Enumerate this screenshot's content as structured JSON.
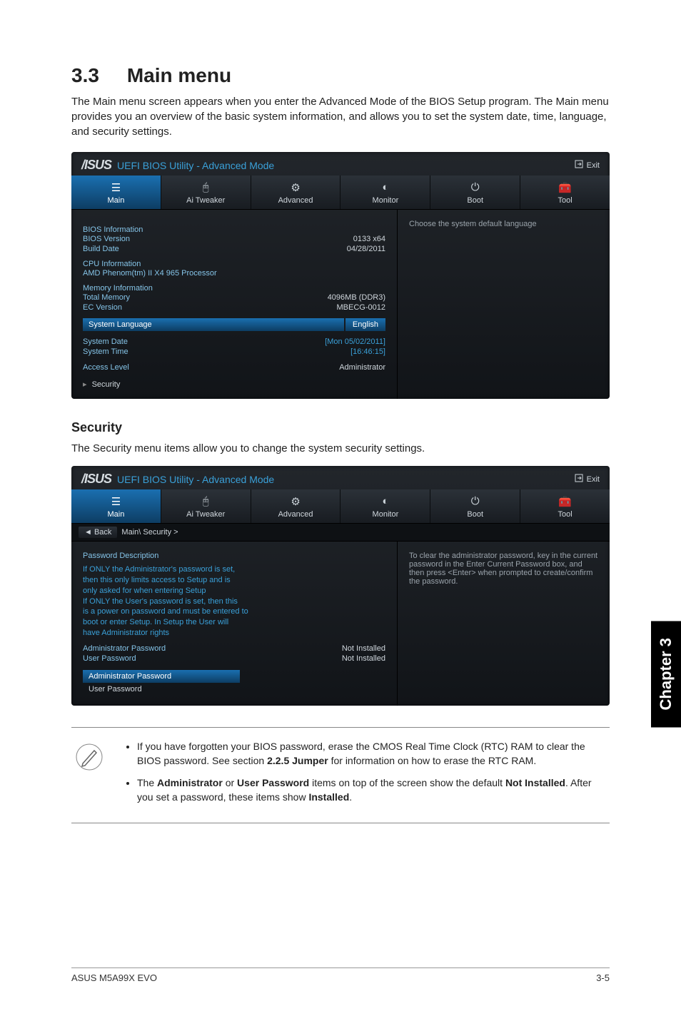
{
  "section": {
    "number": "3.3",
    "title": "Main menu"
  },
  "intro": "The Main menu screen appears when you enter the Advanced Mode of the BIOS Setup program. The Main menu provides you an overview of the basic system information, and allows you to set the system date, time, language, and security settings.",
  "bios_common": {
    "logo": "/ISUS",
    "subtitle": "UEFI BIOS Utility - Advanced Mode",
    "exit_label": "Exit",
    "tabs": [
      {
        "label": "Main",
        "icon": "list-icon"
      },
      {
        "label": "Ai  Tweaker",
        "icon": "slider-icon"
      },
      {
        "label": "Advanced",
        "icon": "chip-icon"
      },
      {
        "label": "Monitor",
        "icon": "gauge-icon"
      },
      {
        "label": "Boot",
        "icon": "power-icon"
      },
      {
        "label": "Tool",
        "icon": "toolbox-icon"
      }
    ]
  },
  "bios1": {
    "right_help": "Choose the system default language",
    "bios_info_title": "BIOS Information",
    "bios_version_label": "BIOS Version",
    "bios_version_value": "0133 x64",
    "build_date_label": "Build Date",
    "build_date_value": "04/28/2011",
    "cpu_info_title": "CPU Information",
    "cpu_name": "AMD Phenom(tm) II X4 965 Processor",
    "mem_info_title": "Memory Information",
    "total_memory_label": "Total Memory",
    "total_memory_value": "4096MB (DDR3)",
    "ec_version_label": "EC Version",
    "ec_version_value": "MBECG-0012",
    "system_language_label": "System Language",
    "system_language_value": "English",
    "system_date_label": "System Date",
    "system_date_value": "[Mon 05/02/2011]",
    "system_time_label": "System Time",
    "system_time_value": "[16:46:15]",
    "access_level_label": "Access Level",
    "access_level_value": "Administrator",
    "security_item": "Security"
  },
  "security_heading": "Security",
  "security_intro": "The Security menu items allow you to change the system security settings.",
  "bios2": {
    "back_label": "Back",
    "breadcrumb": "Main\\ Security  >",
    "right_help": "To clear the administrator password, key in the current password in the Enter Current Password box, and then press <Enter> when prompted to create/confirm the password.",
    "pw_desc_title": "Password Description",
    "desc_lines": [
      "If ONLY the Administrator's password is set,",
      "then this only limits access to Setup and is",
      "only asked for when entering Setup",
      "If ONLY the User's password is set, then this",
      "is a power on password and must be entered to",
      "boot or enter Setup. In Setup the User will",
      "have Administrator rights"
    ],
    "admin_pw_label": "Administrator Password",
    "admin_pw_status": "Not Installed",
    "user_pw_label": "User Password",
    "user_pw_status": "Not Installed",
    "selected_admin": "Administrator Password",
    "selected_user": "User Password"
  },
  "notes": {
    "item1_pre": "If you have forgotten your BIOS password, erase the CMOS Real Time Clock (RTC) RAM to clear the BIOS password. See section ",
    "item1_bold": "2.2.5 Jumper",
    "item1_post": " for information on how to erase the RTC RAM.",
    "item2_pre": "The ",
    "item2_b1": "Administrator",
    "item2_mid1": " or ",
    "item2_b2": "User Password",
    "item2_mid2": " items on top of the screen show the default ",
    "item2_b3": "Not Installed",
    "item2_mid3": ". After you set a password, these items show ",
    "item2_b4": "Installed",
    "item2_post": "."
  },
  "chapter_tab": "Chapter 3",
  "footer": {
    "left": "ASUS M5A99X EVO",
    "right": "3-5"
  }
}
